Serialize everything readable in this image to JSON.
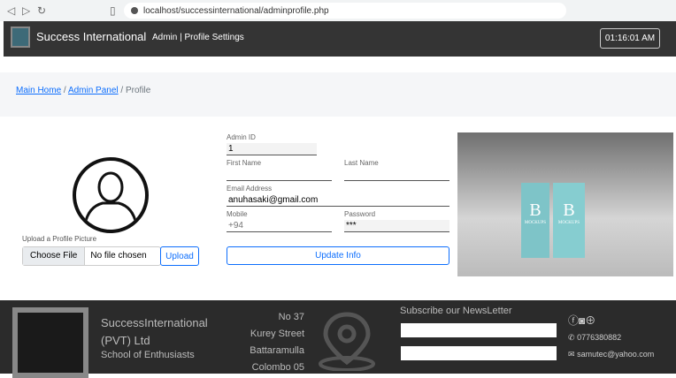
{
  "browser": {
    "url": "localhost/successinternational/adminprofile.php"
  },
  "navbar": {
    "brand": "Success International",
    "title": "Admin | Profile Settings",
    "clock": "01:16:01 AM"
  },
  "breadcrumb": {
    "items": [
      "Main Home",
      "Admin Panel",
      "Profile"
    ],
    "sep": "/"
  },
  "upload": {
    "label": "Upload a Profile Picture",
    "choose": "Choose File",
    "no_file": "No file chosen",
    "button": "Upload"
  },
  "form": {
    "admin_id_label": "Admin ID",
    "admin_id": "1",
    "first_label": "First Name",
    "first": "",
    "last_label": "Last Name",
    "last": "",
    "email_label": "Email Address",
    "email": "anuhasaki@gmail.com",
    "mobile_label": "Mobile",
    "mobile_placeholder": "+94",
    "password_label": "Password",
    "password": "***",
    "update": "Update Info"
  },
  "photo": {
    "book_letter": "B",
    "book_text": "MOCKUPS"
  },
  "footer": {
    "name1": "SuccessInternational",
    "name2": "(PVT) Ltd",
    "tagline": "School of Enthusiasts",
    "address": [
      "No 37",
      "Kurey Street",
      "Battaramulla",
      "Colombo 05"
    ],
    "subscribe": "Subscribe our NewsLetter",
    "phone": "0776380882",
    "email": "samutec@yahoo.com"
  }
}
